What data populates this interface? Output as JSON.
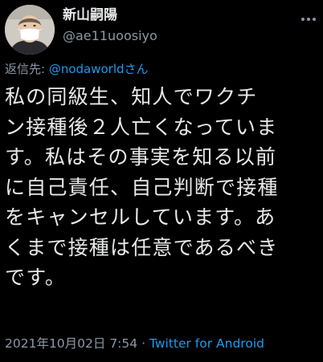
{
  "author": {
    "display_name": "新山嗣陽",
    "handle": "@ae11uoosiyo"
  },
  "reply": {
    "prefix": "返信先: ",
    "mention": "@nodaworldさん"
  },
  "tweet": {
    "lines": [
      "私の同級生、知人でワクチ",
      "ン接種後２人亡くなっていま",
      "す。私はその事実を知る以前",
      "に自己責任、自己判断で接種",
      "をキャンセルしています。あ",
      "くまで接種は任意であるべき",
      "です。"
    ]
  },
  "meta": {
    "timestamp": "2021年10月02日 7:54",
    "separator": " · ",
    "client": "Twitter for Android"
  },
  "colors": {
    "background": "#000000",
    "text": "#e7e9ea",
    "secondary": "#8b98a5",
    "link": "#1d9bf0"
  },
  "icons": {
    "more": "more-horizontal-icon"
  }
}
